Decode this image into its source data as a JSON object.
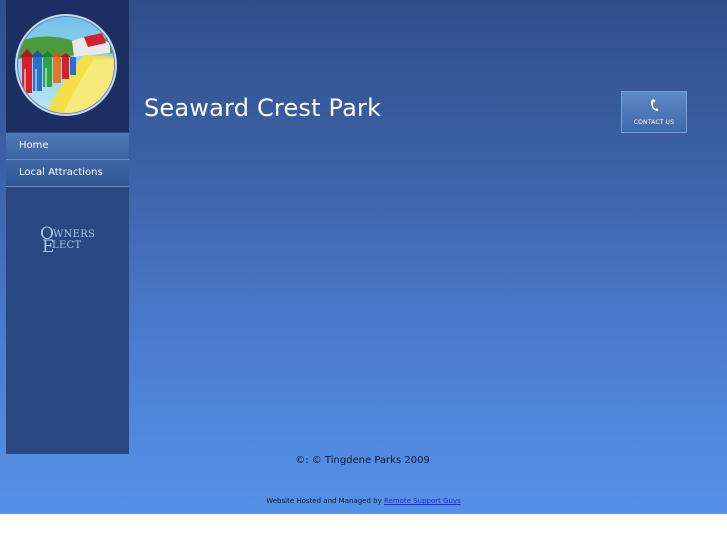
{
  "site": {
    "title": "Seaward Crest Park"
  },
  "sidebar": {
    "nav": [
      {
        "label": "Home"
      },
      {
        "label": "Local Attractions"
      }
    ],
    "partner_logo": {
      "line1_initial": "O",
      "line1_rest": "WNERS",
      "line2_initial": "E",
      "line2_rest": "LECT"
    }
  },
  "header": {
    "contact_button": {
      "label": "CONTACT US",
      "icon": "phone-handset-icon"
    }
  },
  "footer": {
    "copyright": "©: © Tingdene Parks 2009",
    "hosted_prefix": "Website Hosted and Managed by",
    "hosted_link": "Remote Support Guys"
  },
  "colors": {
    "sidebar_bg": "#294780",
    "logo_area_bg": "#1b2f63",
    "link": "#1a2fe0"
  }
}
